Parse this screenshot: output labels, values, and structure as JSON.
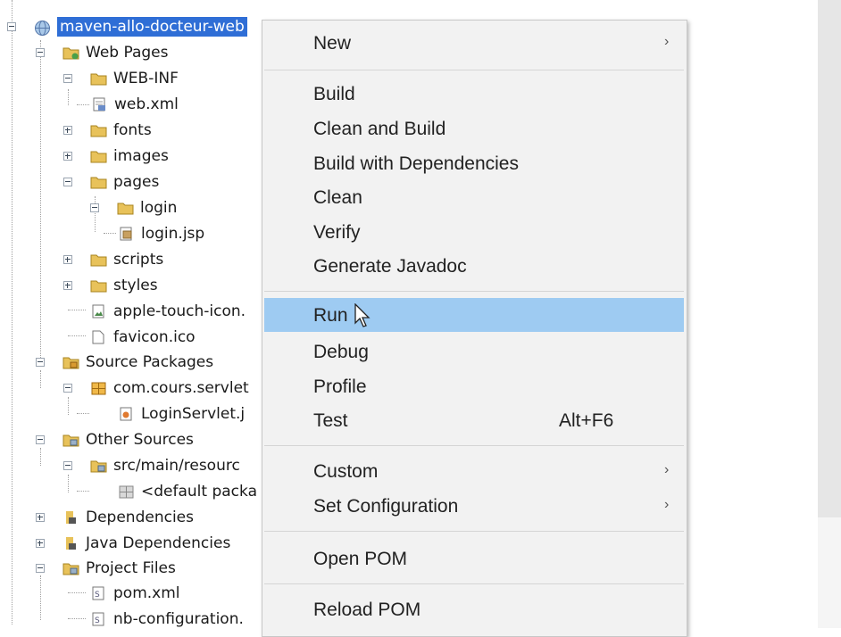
{
  "tree": {
    "items": [
      {
        "label": "maven-allo-docteur-web",
        "icon": "globe-icon"
      },
      {
        "label": "Web Pages",
        "icon": "web-folder-icon"
      },
      {
        "label": "WEB-INF",
        "icon": "folder-icon"
      },
      {
        "label": "web.xml",
        "icon": "xml-file-icon"
      },
      {
        "label": "fonts",
        "icon": "folder-icon"
      },
      {
        "label": "images",
        "icon": "folder-icon"
      },
      {
        "label": "pages",
        "icon": "folder-icon"
      },
      {
        "label": "login",
        "icon": "folder-icon"
      },
      {
        "label": "login.jsp",
        "icon": "jsp-file-icon"
      },
      {
        "label": "scripts",
        "icon": "folder-icon"
      },
      {
        "label": "styles",
        "icon": "folder-icon"
      },
      {
        "label": "apple-touch-icon.",
        "icon": "image-file-icon"
      },
      {
        "label": "favicon.ico",
        "icon": "file-icon"
      },
      {
        "label": "Source Packages",
        "icon": "source-folder-icon"
      },
      {
        "label": "com.cours.servlet",
        "icon": "package-icon"
      },
      {
        "label": "LoginServlet.j",
        "icon": "java-file-icon"
      },
      {
        "label": "Other Sources",
        "icon": "source-folder-icon"
      },
      {
        "label": "src/main/resourc",
        "icon": "source-folder-icon"
      },
      {
        "label": "<default packa",
        "icon": "empty-package-icon"
      },
      {
        "label": "Dependencies",
        "icon": "library-icon"
      },
      {
        "label": "Java Dependencies",
        "icon": "library-icon"
      },
      {
        "label": "Project Files",
        "icon": "source-folder-icon"
      },
      {
        "label": "pom.xml",
        "icon": "config-file-icon"
      },
      {
        "label": "nb-configuration.",
        "icon": "config-file-icon"
      }
    ]
  },
  "menu": {
    "items": [
      {
        "label": "New",
        "submenu": true
      },
      {
        "label": "Build"
      },
      {
        "label": "Clean and Build"
      },
      {
        "label": "Build with Dependencies"
      },
      {
        "label": "Clean"
      },
      {
        "label": "Verify"
      },
      {
        "label": "Generate Javadoc"
      },
      {
        "label": "Run",
        "highlighted": true
      },
      {
        "label": "Debug"
      },
      {
        "label": "Profile"
      },
      {
        "label": "Test",
        "shortcut": "Alt+F6"
      },
      {
        "label": "Custom",
        "submenu": true
      },
      {
        "label": "Set Configuration",
        "submenu": true
      },
      {
        "label": "Open POM"
      },
      {
        "label": "Reload POM"
      }
    ],
    "submenu_glyph": "›"
  },
  "colors": {
    "selection": "#2f6ed6",
    "menu_highlight": "#9ecbf2",
    "folder": "#e8c25a"
  }
}
